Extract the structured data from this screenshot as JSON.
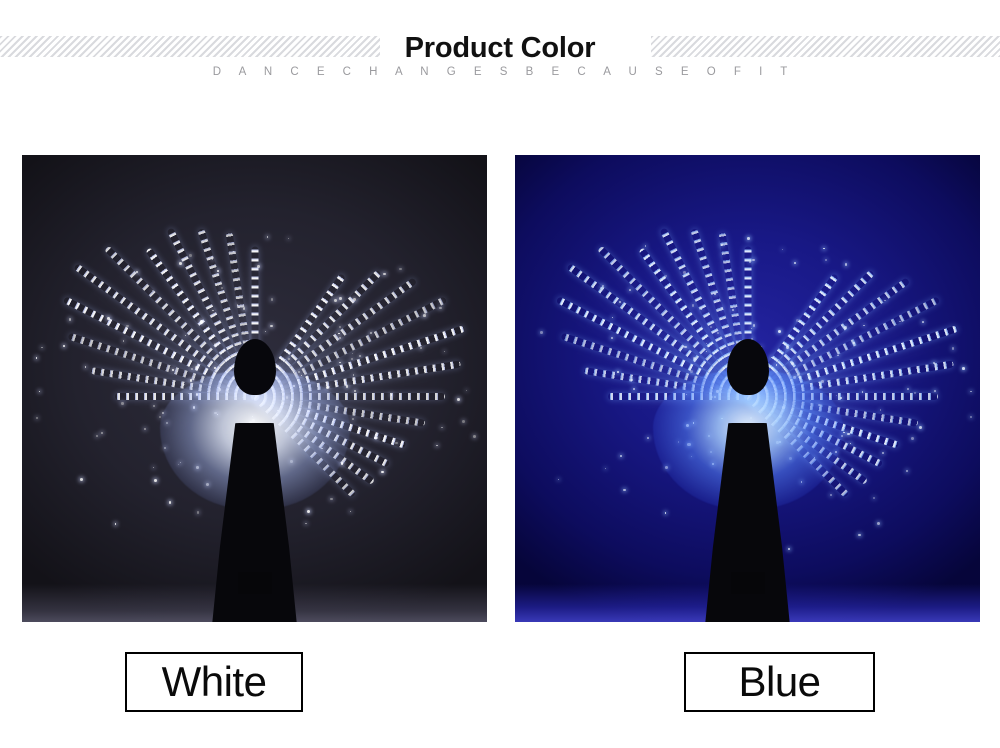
{
  "header": {
    "title": "Product Color",
    "subtitle": "D A N C E C H A  N G E S  B E C A  U S E  O  F I T",
    "hatch_color": "#d9dade",
    "title_color": "#111111",
    "subtitle_color": "#9a9a9e"
  },
  "products": [
    {
      "name": "white-variant",
      "label": "White",
      "photo_alt": "Dancer wearing white LED isis wings, rear view, dark studio background",
      "background_color": "#23222e",
      "led_color": "#ffffff",
      "glow_color": "#cfd6ff"
    },
    {
      "name": "blue-variant",
      "label": "Blue",
      "photo_alt": "Dancer wearing blue LED isis wings, rear view, blue lit background",
      "background_color": "#131276",
      "led_color": "#bcd8ff",
      "glow_color": "#2a55ff"
    }
  ]
}
